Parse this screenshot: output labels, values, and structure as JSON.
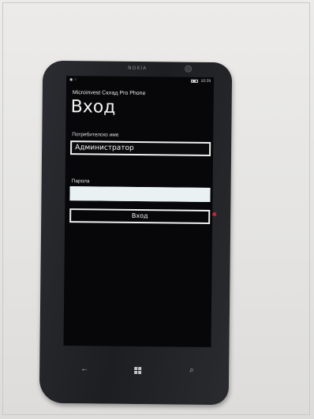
{
  "device": {
    "brand": "NOKIA"
  },
  "status_bar": {
    "left_icons": "◉ ⁙",
    "time": "10:29"
  },
  "app": {
    "title": "Microinvest Склад Pro Phone",
    "page_title": "Вход"
  },
  "form": {
    "username_label": "Потребителско име",
    "username_value": "Администратор",
    "password_label": "Парола",
    "password_value": "",
    "login_button_label": "Вход"
  },
  "nav": {
    "back": "←",
    "search": "⌕"
  },
  "icons": {
    "back": "back-arrow-icon",
    "home": "windows-icon",
    "search": "search-icon",
    "battery": "battery-icon"
  },
  "colors": {
    "screen_background": "#07070a",
    "text": "#f2f2f2",
    "password_field_fill": "#e9f1f3"
  }
}
